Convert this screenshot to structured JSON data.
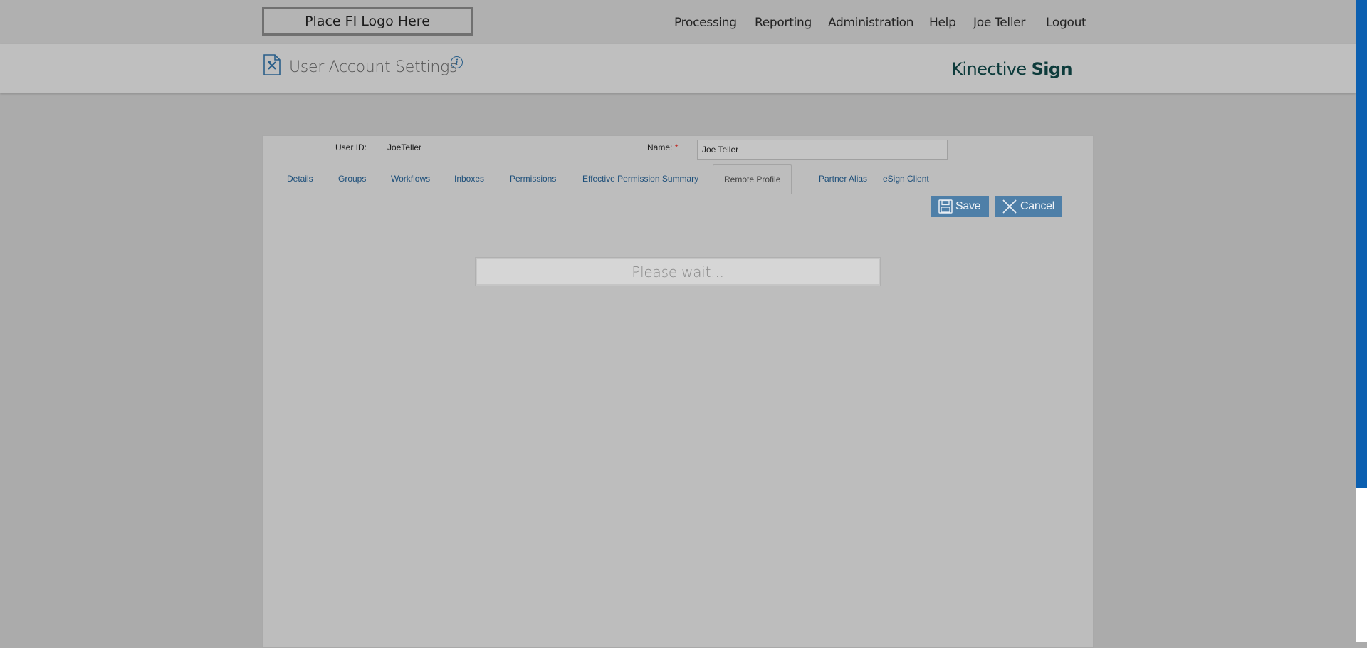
{
  "topnav": {
    "logo_text": "Place FI Logo Here",
    "items": [
      "Processing",
      "Reporting",
      "Administration",
      "Help",
      "Joe Teller",
      "Logout"
    ]
  },
  "header": {
    "title": "User Account Settings",
    "brand_light": "Kinective ",
    "brand_bold": "Sign"
  },
  "form": {
    "user_id_label": "User ID:",
    "user_id_value": "JoeTeller",
    "name_label": "Name:",
    "name_required": "*",
    "name_value": "Joe Teller"
  },
  "tabs": {
    "items": [
      "Details",
      "Groups",
      "Workflows",
      "Inboxes",
      "Permissions",
      "Effective Permission Summary",
      "Remote Profile",
      "Partner Alias",
      "eSign Client"
    ],
    "active": "Remote Profile"
  },
  "actions": {
    "save_label": "Save",
    "cancel_label": "Cancel"
  },
  "status": {
    "loading_text": "Please wait..."
  },
  "colors": {
    "button_bg": "#4e7fa8",
    "link": "#1d4f7a",
    "scrollbar": "#0b5fb0",
    "required": "#c0201a"
  },
  "icons": [
    "document-settings-icon",
    "info-icon",
    "save-disk-icon",
    "close-x-icon"
  ]
}
